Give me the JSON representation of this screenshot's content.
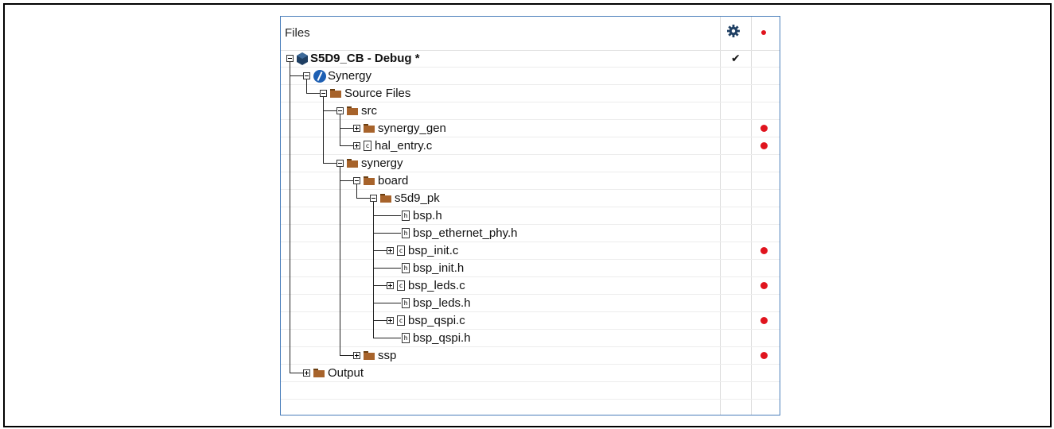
{
  "panel": {
    "header_title": "Files",
    "header_gear_icon": "gear-icon",
    "header_marker": "red-dot"
  },
  "tree": [
    {
      "label": "S5D9_CB - Debug *",
      "depth": 0,
      "type": "project",
      "exp": "minus",
      "bold": true,
      "check": true,
      "dot": false
    },
    {
      "label": "Synergy",
      "depth": 1,
      "type": "synergy",
      "exp": "minus",
      "dot": false
    },
    {
      "label": "Source Files",
      "depth": 2,
      "type": "folder",
      "exp": "minus",
      "dot": false
    },
    {
      "label": "src",
      "depth": 3,
      "type": "folder",
      "exp": "minus",
      "dot": false
    },
    {
      "label": "synergy_gen",
      "depth": 4,
      "type": "folder",
      "exp": "plus",
      "dot": true
    },
    {
      "label": "hal_entry.c",
      "depth": 4,
      "type": "cfile",
      "exp": "plus",
      "dot": true
    },
    {
      "label": "synergy",
      "depth": 3,
      "type": "folder",
      "exp": "minus",
      "dot": false
    },
    {
      "label": "board",
      "depth": 4,
      "type": "folder",
      "exp": "minus",
      "dot": false
    },
    {
      "label": "s5d9_pk",
      "depth": 5,
      "type": "folder",
      "exp": "minus",
      "dot": false
    },
    {
      "label": "bsp.h",
      "depth": 6,
      "type": "hfile",
      "exp": "none",
      "dot": false
    },
    {
      "label": "bsp_ethernet_phy.h",
      "depth": 6,
      "type": "hfile",
      "exp": "none",
      "dot": false
    },
    {
      "label": "bsp_init.c",
      "depth": 6,
      "type": "cfile",
      "exp": "plus",
      "dot": true
    },
    {
      "label": "bsp_init.h",
      "depth": 6,
      "type": "hfile",
      "exp": "none",
      "dot": false
    },
    {
      "label": "bsp_leds.c",
      "depth": 6,
      "type": "cfile",
      "exp": "plus",
      "dot": true
    },
    {
      "label": "bsp_leds.h",
      "depth": 6,
      "type": "hfile",
      "exp": "none",
      "dot": false
    },
    {
      "label": "bsp_qspi.c",
      "depth": 6,
      "type": "cfile",
      "exp": "plus",
      "dot": true
    },
    {
      "label": "bsp_qspi.h",
      "depth": 6,
      "type": "hfile",
      "exp": "none",
      "dot": false
    },
    {
      "label": "ssp",
      "depth": 4,
      "type": "folder",
      "exp": "plus",
      "dot": true
    },
    {
      "label": "Output",
      "depth": 1,
      "type": "folder",
      "exp": "plus",
      "dot": false
    }
  ],
  "colors": {
    "marker_red": "#e0141e",
    "panel_border": "#4a7ebb",
    "folder": "#a7632b"
  }
}
